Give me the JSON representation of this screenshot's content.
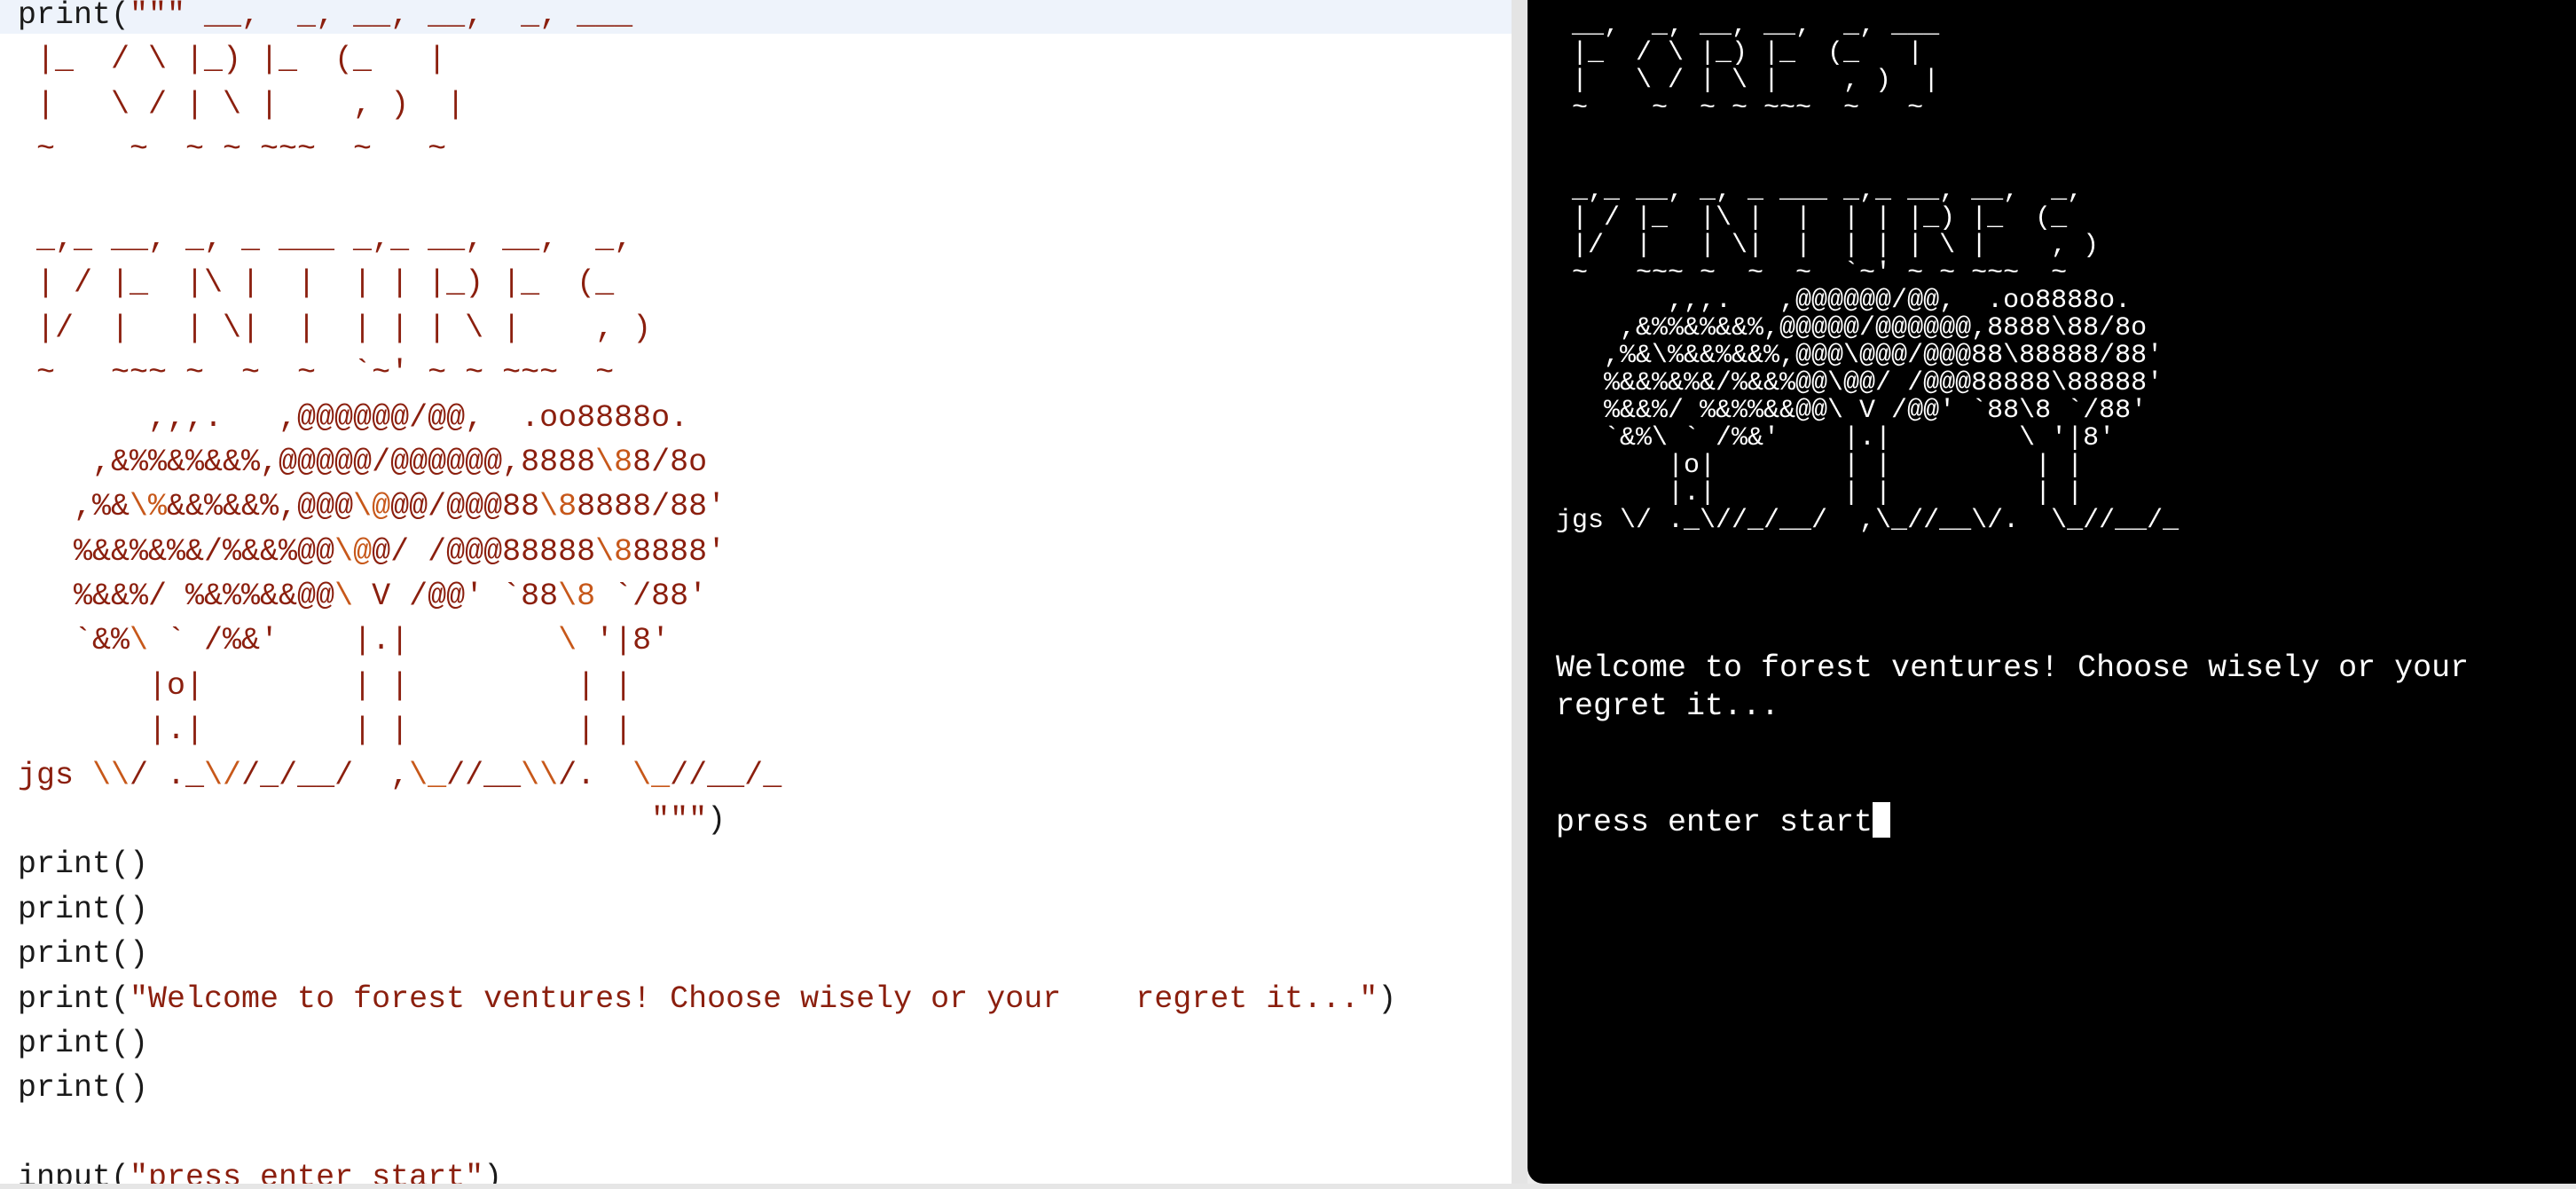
{
  "editor": {
    "lines": [
      [
        {
          "t": "kw",
          "v": "print("
        },
        {
          "t": "str",
          "v": "\"\"\" __,  _, __, __,  _, ___"
        }
      ],
      [
        {
          "t": "str",
          "v": " |_  / \\ |_) |_  (_   |"
        }
      ],
      [
        {
          "t": "str",
          "v": " |   \\ / | \\ |    , )  |"
        }
      ],
      [
        {
          "t": "str",
          "v": " ~    ~  ~ ~ ~~~  ~   ~"
        }
      ],
      [
        {
          "t": "str",
          "v": ""
        }
      ],
      [
        {
          "t": "str",
          "v": " _,_ __, _, _ ___ _,_ __, __,  _,"
        }
      ],
      [
        {
          "t": "str",
          "v": " | / |_  |\\ |  |  | | |_) |_  (_"
        }
      ],
      [
        {
          "t": "str",
          "v": " |/  |   | \\|  |  | | | \\ |    , )"
        }
      ],
      [
        {
          "t": "str",
          "v": " ~   ~~~ ~  ~  ~  `~' ~ ~ ~~~  ~"
        }
      ],
      [
        {
          "t": "str",
          "v": "       ,,,.   ,@@@@@@/@@,  .oo8888o."
        }
      ],
      [
        {
          "t": "str",
          "v": "    ,&%%&%&&%,@@@@@/@@@@@@,8888"
        },
        {
          "t": "esc",
          "v": "\\8"
        },
        {
          "t": "str",
          "v": "8/8o"
        }
      ],
      [
        {
          "t": "str",
          "v": "   ,%&"
        },
        {
          "t": "esc",
          "v": "\\%"
        },
        {
          "t": "str",
          "v": "&&%&&%,@@@"
        },
        {
          "t": "esc",
          "v": "\\@"
        },
        {
          "t": "str",
          "v": "@@/@@@88"
        },
        {
          "t": "esc",
          "v": "\\8"
        },
        {
          "t": "str",
          "v": "8888/88'"
        }
      ],
      [
        {
          "t": "str",
          "v": "   %&&%&%&/%&&%@@"
        },
        {
          "t": "esc",
          "v": "\\@"
        },
        {
          "t": "str",
          "v": "@/ /@@@88888"
        },
        {
          "t": "esc",
          "v": "\\8"
        },
        {
          "t": "str",
          "v": "8888'"
        }
      ],
      [
        {
          "t": "str",
          "v": "   %&&%/ %&%%&&@@"
        },
        {
          "t": "esc",
          "v": "\\ "
        },
        {
          "t": "str",
          "v": "V /@@' `88"
        },
        {
          "t": "esc",
          "v": "\\8"
        },
        {
          "t": "str",
          "v": " `/88'"
        }
      ],
      [
        {
          "t": "str",
          "v": "   `&%"
        },
        {
          "t": "esc",
          "v": "\\ "
        },
        {
          "t": "str",
          "v": "` /%&'    |.|        "
        },
        {
          "t": "esc",
          "v": "\\ "
        },
        {
          "t": "str",
          "v": "'|8'"
        }
      ],
      [
        {
          "t": "str",
          "v": "       |o|        | |         | |"
        }
      ],
      [
        {
          "t": "str",
          "v": "       |.|        | |         | |"
        }
      ],
      [
        {
          "t": "str",
          "v": "jgs "
        },
        {
          "t": "esc",
          "v": "\\\\"
        },
        {
          "t": "str",
          "v": "/ ._"
        },
        {
          "t": "esc",
          "v": "\\/"
        },
        {
          "t": "str",
          "v": "/_/__/  ,"
        },
        {
          "t": "esc",
          "v": "\\_"
        },
        {
          "t": "str",
          "v": "//__"
        },
        {
          "t": "esc",
          "v": "\\\\"
        },
        {
          "t": "str",
          "v": "/.  "
        },
        {
          "t": "esc",
          "v": "\\_"
        },
        {
          "t": "str",
          "v": "//__/_"
        }
      ],
      [
        {
          "t": "str",
          "v": "                                  \"\"\""
        },
        {
          "t": "kw",
          "v": ")"
        }
      ],
      [
        {
          "t": "kw",
          "v": "print()"
        }
      ],
      [
        {
          "t": "kw",
          "v": "print()"
        }
      ],
      [
        {
          "t": "kw",
          "v": "print()"
        }
      ],
      [
        {
          "t": "kw",
          "v": "print("
        },
        {
          "t": "str",
          "v": "\"Welcome to forest ventures! Choose wisely or your    regret it...\""
        },
        {
          "t": "kw",
          "v": ")"
        }
      ],
      [
        {
          "t": "kw",
          "v": "print()"
        }
      ],
      [
        {
          "t": "kw",
          "v": "print()"
        }
      ],
      [
        {
          "t": "kw",
          "v": ""
        }
      ],
      [
        {
          "t": "kw",
          "v": "input("
        },
        {
          "t": "str",
          "v": "\"press enter start\""
        },
        {
          "t": "kw",
          "v": ")"
        }
      ]
    ]
  },
  "console": {
    "art_lines": [
      " __,  _, __, __,  _, ___",
      " |_  / \\ |_) |_  (_   |",
      " |   \\ / | \\ |    , )  |",
      " ~    ~  ~ ~ ~~~  ~   ~",
      "",
      "",
      " _,_ __, _, _ ___ _,_ __, __,  _,",
      " | / |_  |\\ |  |  | | |_) |_  (_",
      " |/  |   | \\|  |  | | | \\ |    , )",
      " ~   ~~~ ~  ~  ~  `~' ~ ~ ~~~  ~",
      "       ,,,.   ,@@@@@@/@@,  .oo8888o.",
      "    ,&%%&%&&%,@@@@@/@@@@@@,8888\\88/8o",
      "   ,%&\\%&&%&&%,@@@\\@@@/@@@88\\88888/88'",
      "   %&&%&%&/%&&%@@\\@@/ /@@@88888\\88888'",
      "   %&&%/ %&%%&&@@\\ V /@@' `88\\8 `/88'",
      "   `&%\\ ` /%&'    |.|        \\ '|8'",
      "       |o|        | |         | |",
      "       |.|        | |         | |",
      "jgs \\/ ._\\//_/__/  ,\\_//__\\/.  \\_//__/_"
    ],
    "welcome_line_1": "Welcome to forest ventures! Choose wisely or your",
    "welcome_line_2": "regret it...",
    "prompt": "press enter start"
  }
}
